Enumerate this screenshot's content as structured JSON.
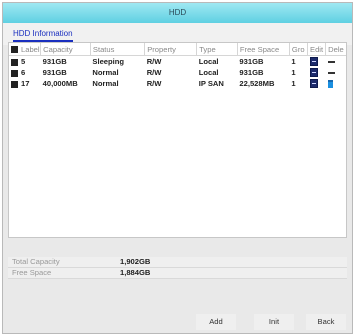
{
  "window": {
    "title": "HDD"
  },
  "tabs": [
    {
      "label": "HDD Information"
    }
  ],
  "table": {
    "headers": [
      "Label",
      "Capacity",
      "Status",
      "Property",
      "Type",
      "Free Space",
      "Gro",
      "Edit",
      "Dele"
    ],
    "rows": [
      {
        "label": "5",
        "capacity": "931GB",
        "status": "Sleeping",
        "property": "R/W",
        "type": "Local",
        "free": "931GB",
        "group": "1",
        "delete_icon": "minus-icon"
      },
      {
        "label": "6",
        "capacity": "931GB",
        "status": "Normal",
        "property": "R/W",
        "type": "Local",
        "free": "931GB",
        "group": "1",
        "delete_icon": "minus-icon"
      },
      {
        "label": "17",
        "capacity": "40,000MB",
        "status": "Normal",
        "property": "R/W",
        "type": "IP SAN",
        "free": "22,528MB",
        "group": "1",
        "delete_icon": "trash-icon"
      }
    ]
  },
  "summary": {
    "total_capacity_label": "Total Capacity",
    "total_capacity_value": "1,902GB",
    "free_space_label": "Free Space",
    "free_space_value": "1,884GB"
  },
  "buttons": {
    "add": "Add",
    "init": "Init",
    "back": "Back"
  },
  "colors": {
    "accent": "#5fd0e2",
    "link": "#1a2fbf",
    "trash": "#1a8fe0"
  }
}
